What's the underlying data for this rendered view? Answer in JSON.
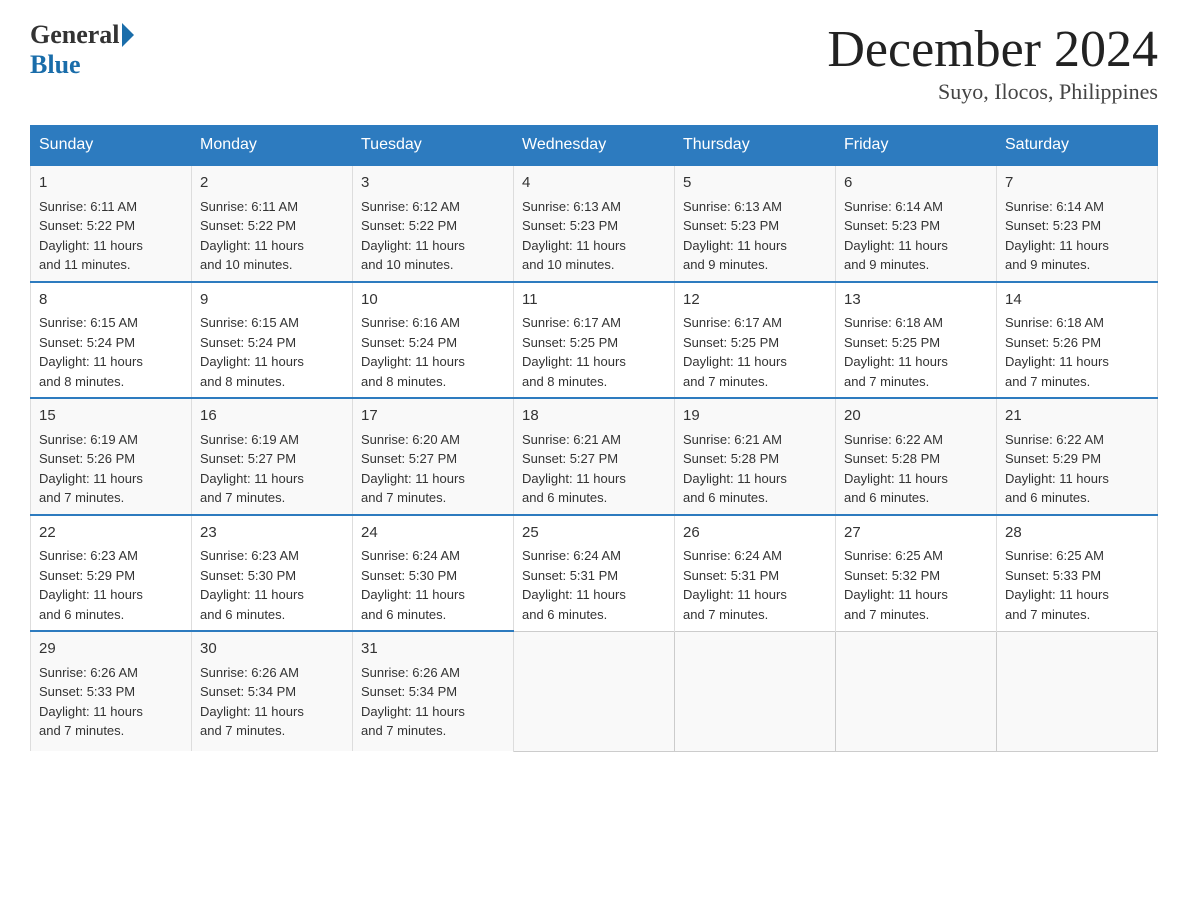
{
  "header": {
    "logo_general": "General",
    "logo_blue": "Blue",
    "month_title": "December 2024",
    "subtitle": "Suyo, Ilocos, Philippines"
  },
  "days_of_week": [
    "Sunday",
    "Monday",
    "Tuesday",
    "Wednesday",
    "Thursday",
    "Friday",
    "Saturday"
  ],
  "weeks": [
    [
      {
        "day": "1",
        "sunrise": "6:11 AM",
        "sunset": "5:22 PM",
        "daylight": "11 hours and 11 minutes."
      },
      {
        "day": "2",
        "sunrise": "6:11 AM",
        "sunset": "5:22 PM",
        "daylight": "11 hours and 10 minutes."
      },
      {
        "day": "3",
        "sunrise": "6:12 AM",
        "sunset": "5:22 PM",
        "daylight": "11 hours and 10 minutes."
      },
      {
        "day": "4",
        "sunrise": "6:13 AM",
        "sunset": "5:23 PM",
        "daylight": "11 hours and 10 minutes."
      },
      {
        "day": "5",
        "sunrise": "6:13 AM",
        "sunset": "5:23 PM",
        "daylight": "11 hours and 9 minutes."
      },
      {
        "day": "6",
        "sunrise": "6:14 AM",
        "sunset": "5:23 PM",
        "daylight": "11 hours and 9 minutes."
      },
      {
        "day": "7",
        "sunrise": "6:14 AM",
        "sunset": "5:23 PM",
        "daylight": "11 hours and 9 minutes."
      }
    ],
    [
      {
        "day": "8",
        "sunrise": "6:15 AM",
        "sunset": "5:24 PM",
        "daylight": "11 hours and 8 minutes."
      },
      {
        "day": "9",
        "sunrise": "6:15 AM",
        "sunset": "5:24 PM",
        "daylight": "11 hours and 8 minutes."
      },
      {
        "day": "10",
        "sunrise": "6:16 AM",
        "sunset": "5:24 PM",
        "daylight": "11 hours and 8 minutes."
      },
      {
        "day": "11",
        "sunrise": "6:17 AM",
        "sunset": "5:25 PM",
        "daylight": "11 hours and 8 minutes."
      },
      {
        "day": "12",
        "sunrise": "6:17 AM",
        "sunset": "5:25 PM",
        "daylight": "11 hours and 7 minutes."
      },
      {
        "day": "13",
        "sunrise": "6:18 AM",
        "sunset": "5:25 PM",
        "daylight": "11 hours and 7 minutes."
      },
      {
        "day": "14",
        "sunrise": "6:18 AM",
        "sunset": "5:26 PM",
        "daylight": "11 hours and 7 minutes."
      }
    ],
    [
      {
        "day": "15",
        "sunrise": "6:19 AM",
        "sunset": "5:26 PM",
        "daylight": "11 hours and 7 minutes."
      },
      {
        "day": "16",
        "sunrise": "6:19 AM",
        "sunset": "5:27 PM",
        "daylight": "11 hours and 7 minutes."
      },
      {
        "day": "17",
        "sunrise": "6:20 AM",
        "sunset": "5:27 PM",
        "daylight": "11 hours and 7 minutes."
      },
      {
        "day": "18",
        "sunrise": "6:21 AM",
        "sunset": "5:27 PM",
        "daylight": "11 hours and 6 minutes."
      },
      {
        "day": "19",
        "sunrise": "6:21 AM",
        "sunset": "5:28 PM",
        "daylight": "11 hours and 6 minutes."
      },
      {
        "day": "20",
        "sunrise": "6:22 AM",
        "sunset": "5:28 PM",
        "daylight": "11 hours and 6 minutes."
      },
      {
        "day": "21",
        "sunrise": "6:22 AM",
        "sunset": "5:29 PM",
        "daylight": "11 hours and 6 minutes."
      }
    ],
    [
      {
        "day": "22",
        "sunrise": "6:23 AM",
        "sunset": "5:29 PM",
        "daylight": "11 hours and 6 minutes."
      },
      {
        "day": "23",
        "sunrise": "6:23 AM",
        "sunset": "5:30 PM",
        "daylight": "11 hours and 6 minutes."
      },
      {
        "day": "24",
        "sunrise": "6:24 AM",
        "sunset": "5:30 PM",
        "daylight": "11 hours and 6 minutes."
      },
      {
        "day": "25",
        "sunrise": "6:24 AM",
        "sunset": "5:31 PM",
        "daylight": "11 hours and 6 minutes."
      },
      {
        "day": "26",
        "sunrise": "6:24 AM",
        "sunset": "5:31 PM",
        "daylight": "11 hours and 7 minutes."
      },
      {
        "day": "27",
        "sunrise": "6:25 AM",
        "sunset": "5:32 PM",
        "daylight": "11 hours and 7 minutes."
      },
      {
        "day": "28",
        "sunrise": "6:25 AM",
        "sunset": "5:33 PM",
        "daylight": "11 hours and 7 minutes."
      }
    ],
    [
      {
        "day": "29",
        "sunrise": "6:26 AM",
        "sunset": "5:33 PM",
        "daylight": "11 hours and 7 minutes."
      },
      {
        "day": "30",
        "sunrise": "6:26 AM",
        "sunset": "5:34 PM",
        "daylight": "11 hours and 7 minutes."
      },
      {
        "day": "31",
        "sunrise": "6:26 AM",
        "sunset": "5:34 PM",
        "daylight": "11 hours and 7 minutes."
      },
      null,
      null,
      null,
      null
    ]
  ],
  "labels": {
    "sunrise": "Sunrise:",
    "sunset": "Sunset:",
    "daylight": "Daylight:"
  }
}
